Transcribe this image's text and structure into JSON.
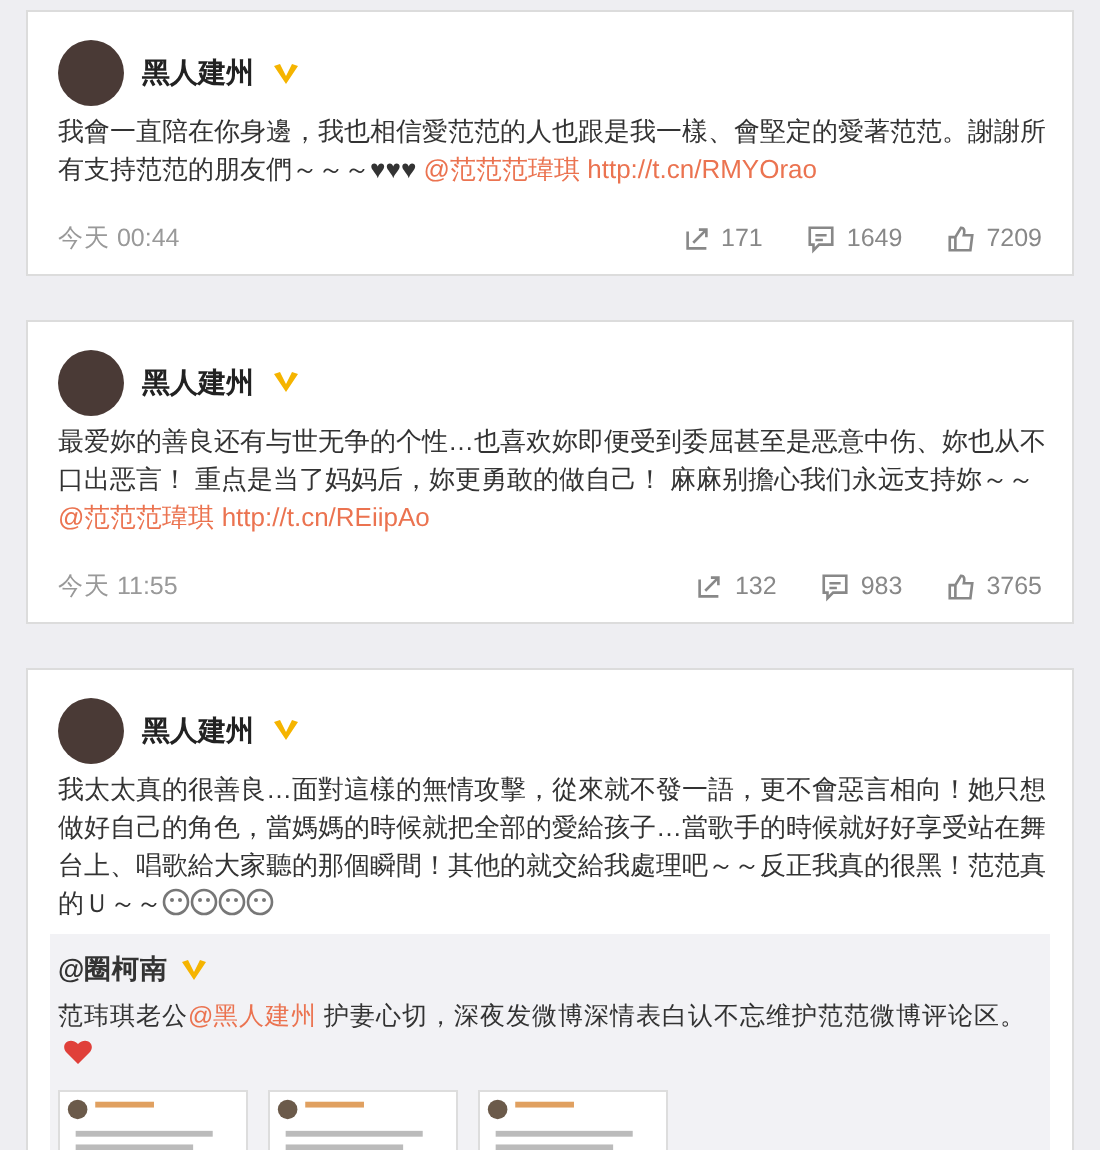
{
  "posts": [
    {
      "author": "黑人建州",
      "verified": true,
      "text": "我會一直陪在你身邊，我也相信愛范范的人也跟是我一樣、會堅定的愛著范范。謝謝所有支持范范的朋友們～～～♥♥♥ ",
      "mention": "@范范范瑋琪",
      "url": "http://t.cn/RMYOrao",
      "time": "今天 00:44",
      "reposts": "171",
      "comments": "1649",
      "likes": "7209"
    },
    {
      "author": "黑人建州",
      "verified": true,
      "text": "最爱妳的善良还有与世无争的个性…也喜欢妳即便受到委屈甚至是恶意中伤、妳也从不口出恶言！ 重点是当了妈妈后，妳更勇敢的做自己！ 麻麻别擔心我们永远支持妳～～",
      "mention": "@范范范瑋琪",
      "url": "http://t.cn/REiipAo",
      "time": "今天 11:55",
      "reposts": "132",
      "comments": "983",
      "likes": "3765"
    },
    {
      "author": "黑人建州",
      "verified": true,
      "text": "我太太真的很善良…面對這樣的無情攻擊，從來就不發一語，更不會惡言相向！她只想做好自己的角色，當媽媽的時候就把全部的愛給孩子…當歌手的時候就好好享受站在舞台上、唱歌給大家聽的那個瞬間！其他的就交給我處理吧～～反正我真的很黑！范范真的Ｕ～～",
      "emojis": [
        {
          "kind": "smiley"
        },
        {
          "kind": "smiley"
        },
        {
          "kind": "smiley"
        },
        {
          "kind": "smiley"
        }
      ],
      "repost": {
        "author": "@圈柯南",
        "verified": true,
        "text_before": "范玮琪老公",
        "mention": "@黑人建州",
        "text_after": " 护妻心切，深夜发微博深情表白认不忘维护范范微博评论区。",
        "heart": true
      }
    }
  ]
}
